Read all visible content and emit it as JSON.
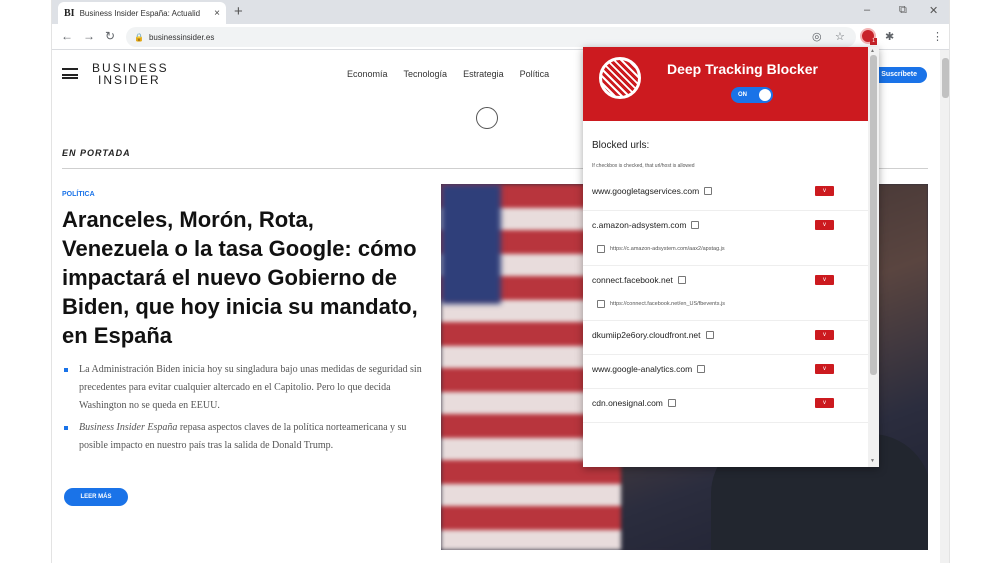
{
  "browser": {
    "tab_favicon": "BI",
    "tab_title": "Business Insider España: Actualid",
    "tab_close": "×",
    "new_tab": "+",
    "url": "businessinsider.es",
    "window_controls": [
      "–",
      "⧉",
      "✕"
    ],
    "ext_badge": "1"
  },
  "site": {
    "logo_line1": "BUSINESS",
    "logo_line2": "INSIDER",
    "nav": [
      "Economía",
      "Tecnología",
      "Estrategia",
      "Política"
    ],
    "subscribe_label": "Suscríbete",
    "section_label": "EN PORTADA",
    "category": "POLÍTICA",
    "headline": "Aranceles, Morón, Rota, Venezuela o la tasa Google: cómo impactará el nuevo Gobierno de Biden, que hoy inicia su mandato, en España",
    "bullet1": "La Administración Biden inicia hoy su singladura bajo unas medidas de seguridad sin precedentes para evitar cualquier altercado en el Capitolio. Pero lo que decida Washington no se queda en EEUU.",
    "bullet2_italic": "Business Insider España",
    "bullet2_rest": " repasa aspectos claves de la política norteamericana y su posible impacto en nuestro país tras la salida de Donald Trump.",
    "read_more": "LEER MÁS"
  },
  "extension": {
    "title": "Deep Tracking Blocker",
    "toggle_label": "ON",
    "blocked_title": "Blocked urls:",
    "blocked_hint": "If checkbox is checked, that url/host is allowed",
    "expand_glyph": "v",
    "urls": [
      {
        "host": "www.googletagservices.com"
      },
      {
        "host": "c.amazon-adsystem.com",
        "sub": "https://c.amazon-adsystem.com/aax2/apstag.js"
      },
      {
        "host": "connect.facebook.net",
        "sub": "https://connect.facebook.net/en_US/fbevents.js"
      },
      {
        "host": "dkumiip2e6ory.cloudfront.net"
      },
      {
        "host": "www.google-analytics.com"
      },
      {
        "host": "cdn.onesignal.com"
      }
    ]
  },
  "icons": {
    "back": "back-arrow-icon",
    "forward": "forward-arrow-icon",
    "reload": "reload-icon",
    "lock": "lock-icon",
    "eye_off": "eye-off-icon",
    "star": "star-icon",
    "extension": "tracking-blocker-icon",
    "puzzle": "puzzle-icon",
    "menu": "kebab-menu-icon"
  }
}
